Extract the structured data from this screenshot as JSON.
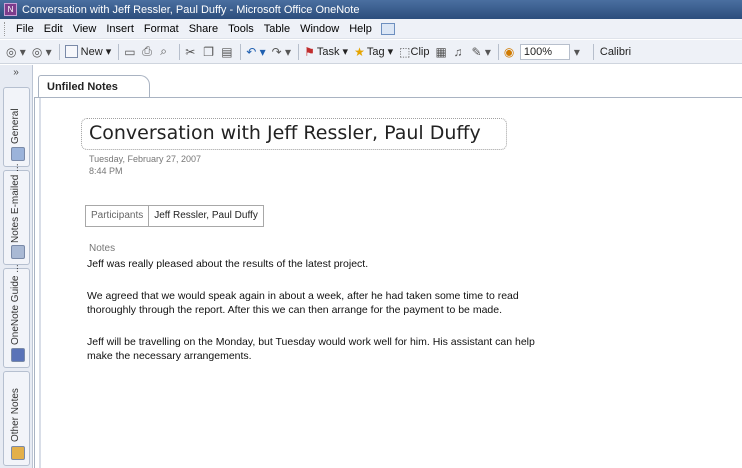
{
  "window": {
    "title": "Conversation with Jeff Ressler, Paul Duffy - Microsoft Office OneNote"
  },
  "menu": [
    "File",
    "Edit",
    "View",
    "Insert",
    "Format",
    "Share",
    "Tools",
    "Table",
    "Window",
    "Help"
  ],
  "toolbar": {
    "new_label": "New",
    "task_label": "Task",
    "tag_label": "Tag",
    "clip_label": "Clip",
    "zoom_value": "100%",
    "font_value": "Calibri"
  },
  "sidebar": {
    "expand_label": "»",
    "notebooks": [
      {
        "label": "General",
        "color": "#9bb3da"
      },
      {
        "label": "Notes E-mailed ...",
        "color": "#a9b9d4"
      },
      {
        "label": "OneNote Guide ...",
        "color": "#5a73b8"
      },
      {
        "label": "Other Notes",
        "color": "#e3b04a"
      }
    ]
  },
  "section_tab": {
    "label": "Unfiled Notes"
  },
  "page": {
    "title": "Conversation with Jeff Ressler, Paul Duffy",
    "date": "Tuesday, February 27, 2007",
    "time": "8:44 PM",
    "participants_label": "Participants",
    "participants_value": "Jeff Ressler, Paul Duffy",
    "notes_label": "Notes",
    "lines": [
      "Jeff was really pleased about the results of the latest project.",
      "We agreed that we would speak again in about a week, after he had taken some time to read",
      "thoroughly through the report.  After this we can then arrange for the payment to be made.",
      "Jeff will be travelling on the Monday, but Tuesday would work well for him.  His assistant can help",
      "make the necessary arrangements."
    ]
  }
}
